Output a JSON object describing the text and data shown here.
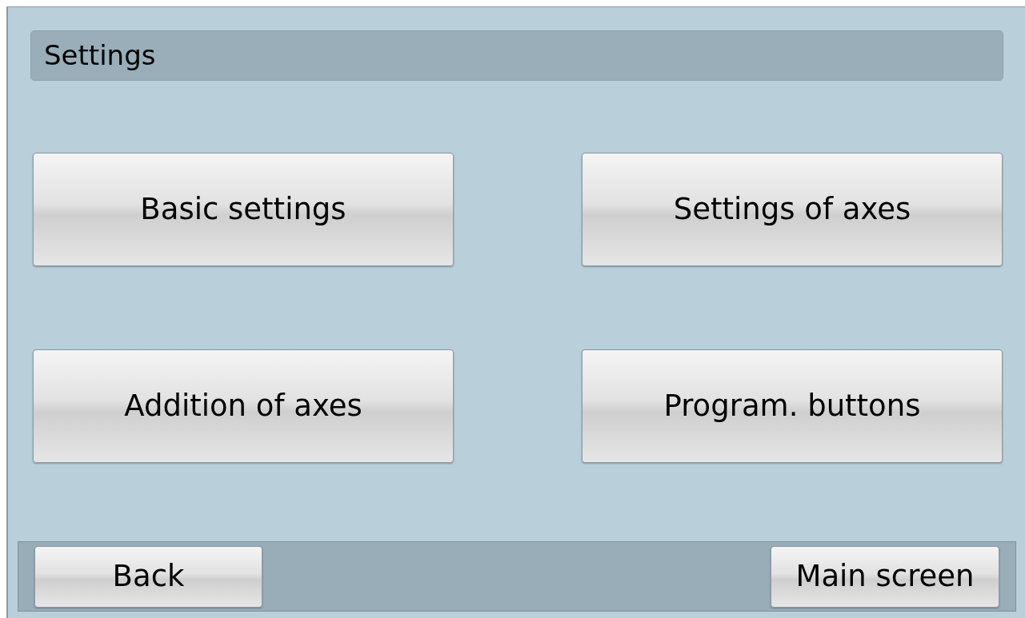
{
  "header": {
    "title": "Settings"
  },
  "menu_buttons": [
    {
      "label": "Basic settings"
    },
    {
      "label": "Settings of axes"
    },
    {
      "label": "Addition of axes"
    },
    {
      "label": "Program. buttons"
    }
  ],
  "footer": {
    "buttons": [
      {
        "label": "Back"
      },
      {
        "label": "Main screen"
      }
    ]
  }
}
